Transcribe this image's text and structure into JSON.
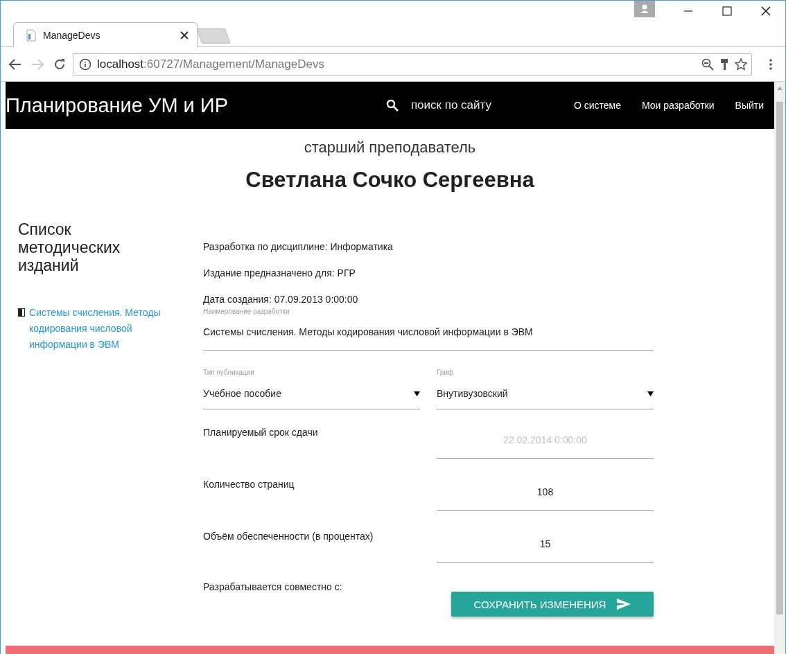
{
  "browser": {
    "tab": {
      "title": "ManageDevs"
    },
    "url": {
      "host": "localhost",
      "rest": ":60727/Management/ManageDevs"
    }
  },
  "header": {
    "brand": "Планирование УМ и ИР",
    "search": {
      "placeholder": "поиск по сайту"
    },
    "nav": [
      {
        "label": "О системе"
      },
      {
        "label": "Мои разработки"
      },
      {
        "label": "Выйти"
      }
    ]
  },
  "profile": {
    "position": "старший преподаватель",
    "name": "Светлана Сочко Сергеевна"
  },
  "sidebar": {
    "title": "Список методических изданий",
    "items": [
      {
        "label": "Системы счисления. Методы кодирования числовой информации в ЭВМ"
      }
    ]
  },
  "info": [
    "Разработка по дисциплине: Информатика",
    "Издание предназначено для: РГР",
    "Дата создания: 07.09.2013 0:00:00"
  ],
  "form": {
    "name_field": {
      "label": "Наимерование разработки",
      "value": "Системы счисления. Методы кодирования числовой информации в ЭВМ"
    },
    "selects": [
      {
        "label": "Тип публикации",
        "value": "Учебное пособие"
      },
      {
        "label": "Гриф",
        "value": "Внутивузовский"
      }
    ],
    "rows": [
      {
        "label": "Планируемый срок сдачи",
        "value": "22.02.2014 0:00:00",
        "disabled": true
      },
      {
        "label": "Количество страниц",
        "value": "108",
        "disabled": false
      },
      {
        "label": "Объём обеспеченности (в процентах)",
        "value": "15",
        "disabled": false
      }
    ],
    "coauthors_label": "Разрабатывается совместно с:",
    "submit": "СОХРАНИТЬ ИЗМЕНЕНИЯ"
  }
}
